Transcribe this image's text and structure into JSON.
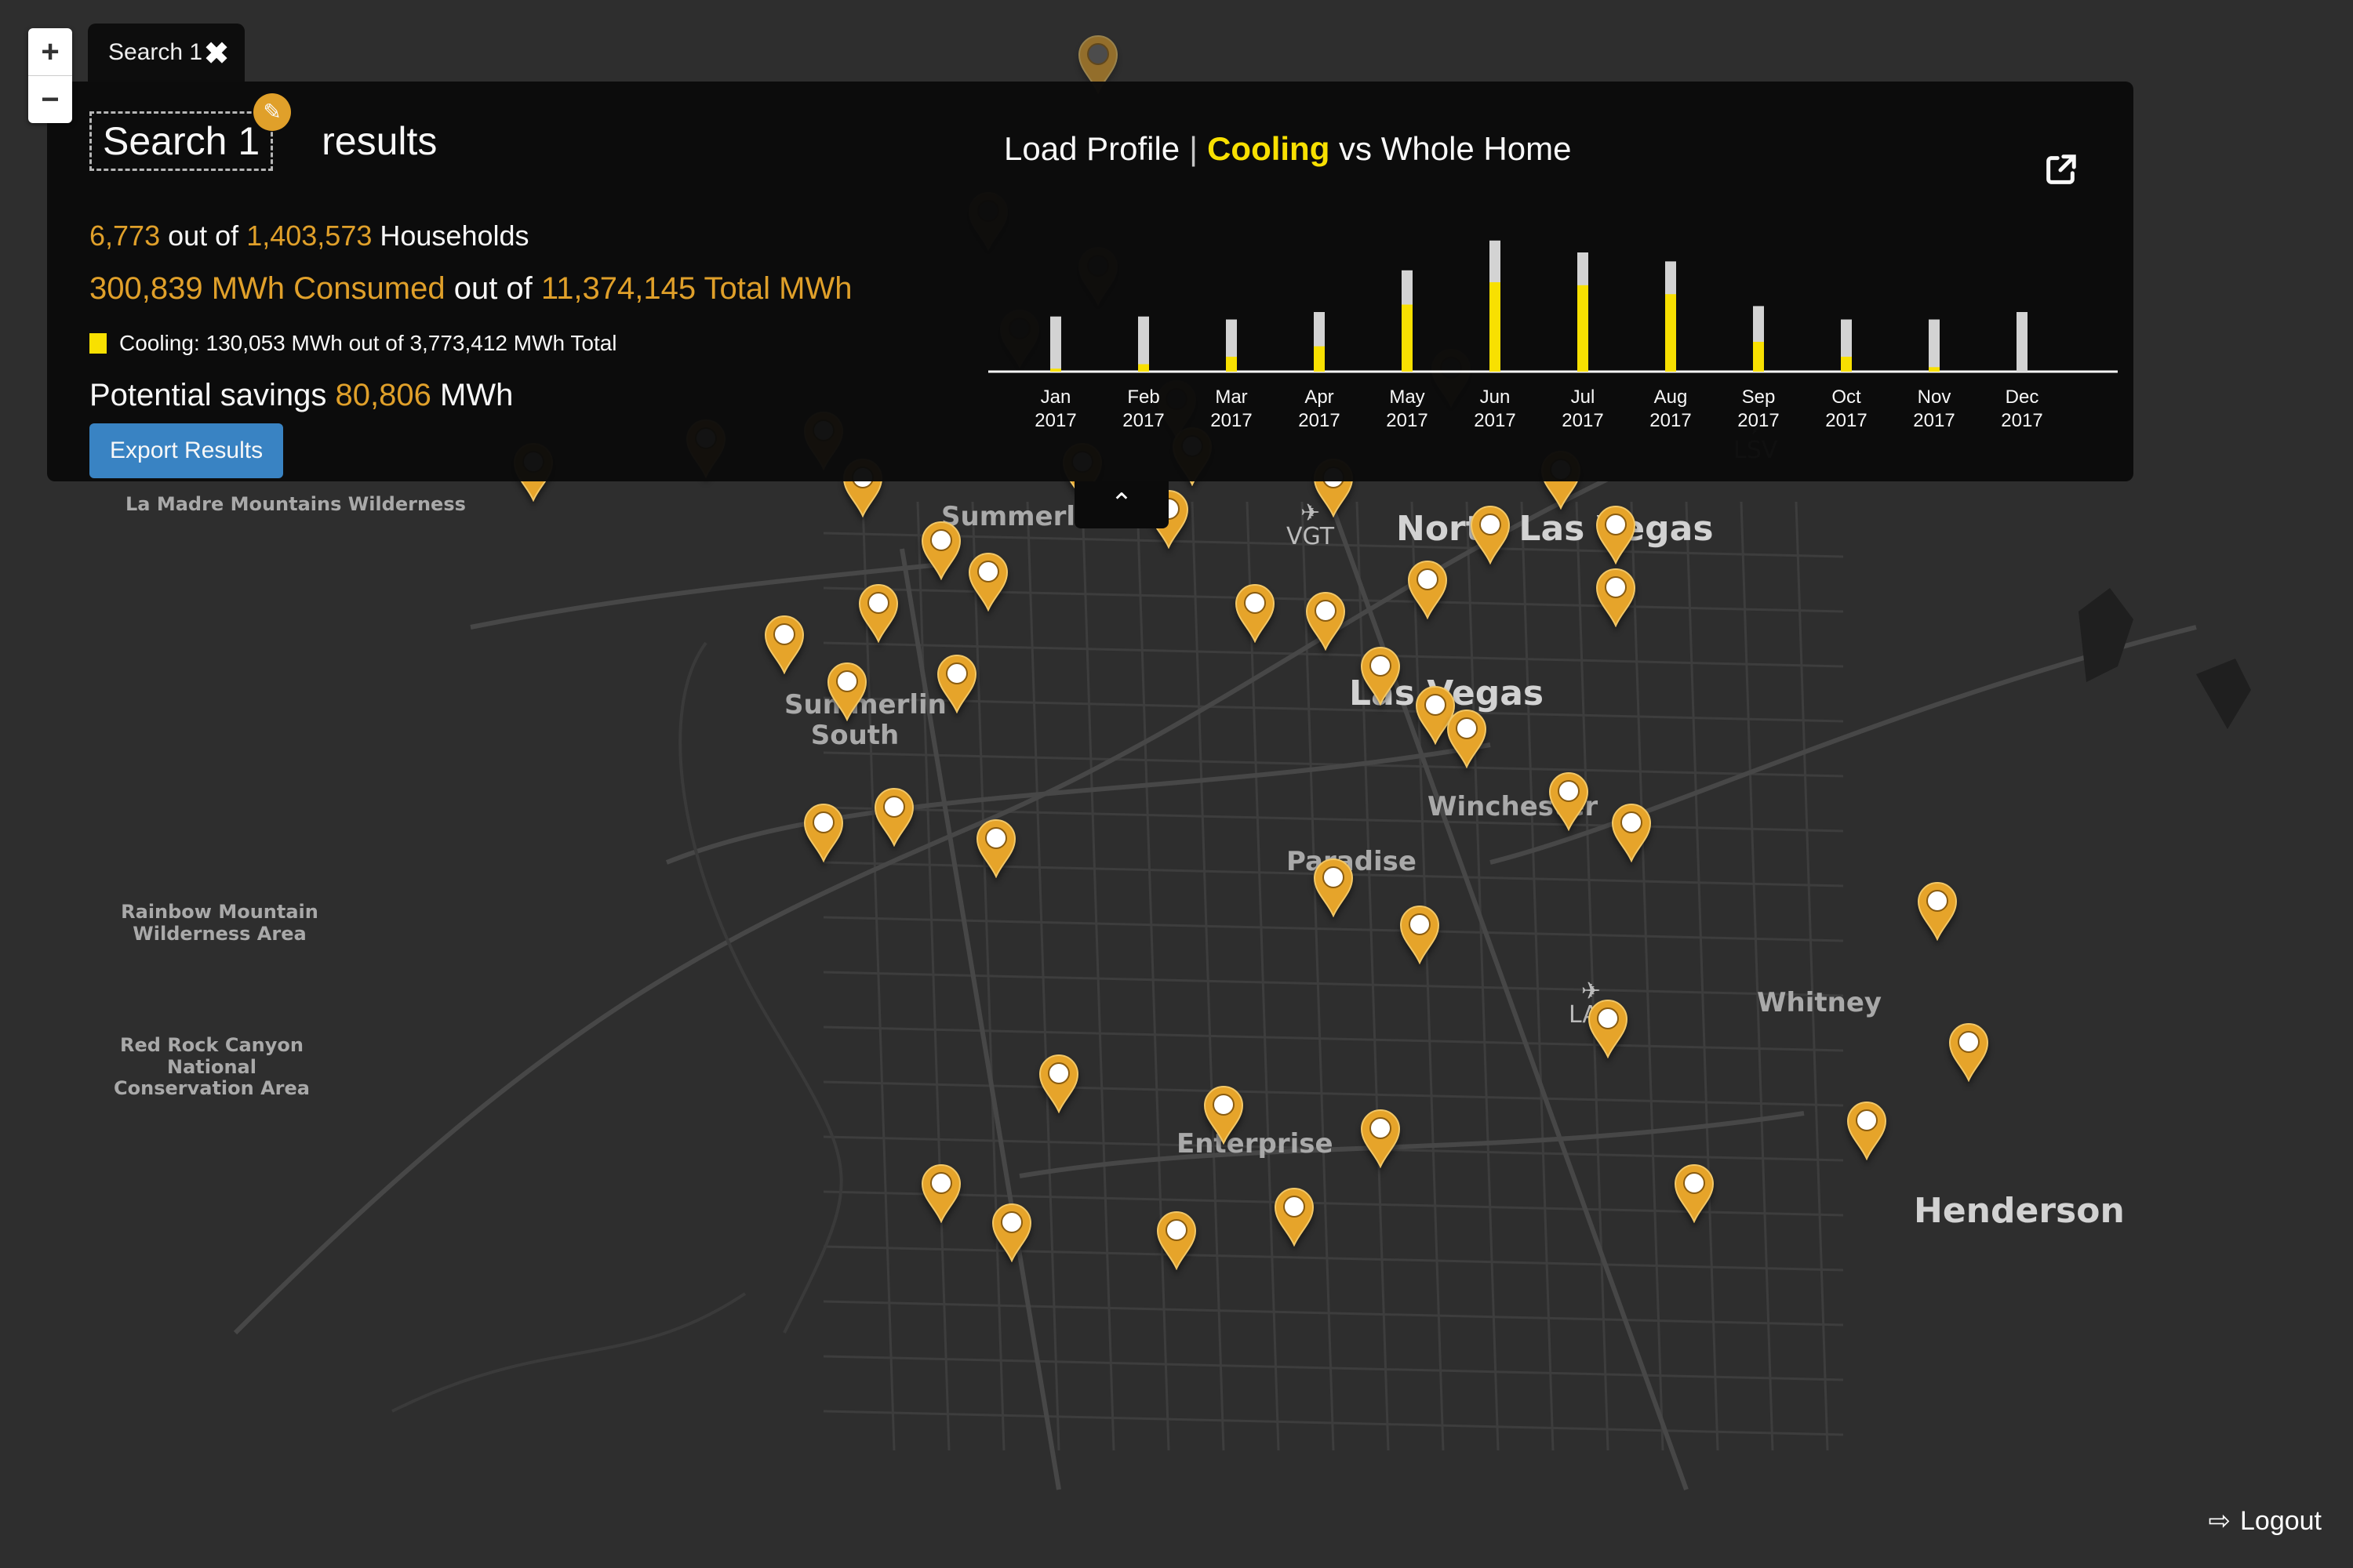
{
  "map_controls": {
    "zoom_in": "+",
    "zoom_out": "−"
  },
  "tab": {
    "label": "Search 1",
    "close_icon": "✖"
  },
  "results": {
    "search_name": "Search 1",
    "edit_icon": "✎",
    "results_word": "results",
    "households_selected": "6,773",
    "out_of": "out of",
    "households_total": "1,403,573",
    "households_label": "Households",
    "consumed": "300,839 MWh Consumed",
    "total_mwh": "11,374,145 Total MWh",
    "cooling_line": "Cooling: 130,053 MWh out of 3,773,412 MWh Total",
    "savings_label": "Potential savings",
    "savings_value": "80,806",
    "savings_unit": "MWh",
    "export_label": "Export Results"
  },
  "colors": {
    "accent": "#e6a42a",
    "cooling": "#ffe600",
    "whole_home": "#d9d9d9",
    "button": "#3a86c8",
    "panel": "#0b0b0b",
    "map": "#2e2e2e"
  },
  "chart_data": {
    "type": "bar",
    "title": "Load Profile | Cooling vs Whole Home",
    "title_parts": {
      "prefix": "Load Profile",
      "separator": "|",
      "highlight": "Cooling",
      "suffix": "vs Whole Home"
    },
    "categories": [
      "Jan 2017",
      "Feb 2017",
      "Mar 2017",
      "Apr 2017",
      "May 2017",
      "Jun 2017",
      "Jul 2017",
      "Aug 2017",
      "Sep 2017",
      "Oct 2017",
      "Nov 2017",
      "Dec 2017"
    ],
    "series": [
      {
        "name": "Whole Home",
        "values": [
          0.37,
          0.37,
          0.35,
          0.4,
          0.68,
          0.88,
          0.8,
          0.74,
          0.44,
          0.35,
          0.35,
          0.4
        ]
      },
      {
        "name": "Cooling",
        "values": [
          0.02,
          0.05,
          0.1,
          0.17,
          0.45,
          0.6,
          0.58,
          0.52,
          0.2,
          0.1,
          0.03,
          0.0
        ]
      }
    ],
    "units": "relative",
    "ylim": [
      0,
      1
    ],
    "grid": false,
    "legend": "none",
    "xlabel": "",
    "ylabel": ""
  },
  "map": {
    "places": [
      {
        "name": "La Madre Mountains Wilderness",
        "cls": "small"
      },
      {
        "name": "Summerlin",
        "cls": "mid"
      },
      {
        "name": "North Las Vegas",
        "cls": "big"
      },
      {
        "name": "Las Vegas",
        "cls": "big"
      },
      {
        "name": "Summerlin South",
        "cls": "mid"
      },
      {
        "name": "Paradise",
        "cls": "mid"
      },
      {
        "name": "Winchester",
        "cls": "mid"
      },
      {
        "name": "Rainbow Mountain Wilderness Area",
        "cls": "small"
      },
      {
        "name": "Red Rock Canyon National Conservation Area",
        "cls": "small"
      },
      {
        "name": "Whitney",
        "cls": "mid"
      },
      {
        "name": "Enterprise",
        "cls": "mid"
      },
      {
        "name": "Henderson",
        "cls": "big"
      }
    ],
    "airports": [
      "VGT",
      "LAS",
      "LSV"
    ],
    "pin_count": 46
  },
  "collapse_icon": "⌃",
  "logout": {
    "label": "Logout",
    "icon": "⇨"
  }
}
